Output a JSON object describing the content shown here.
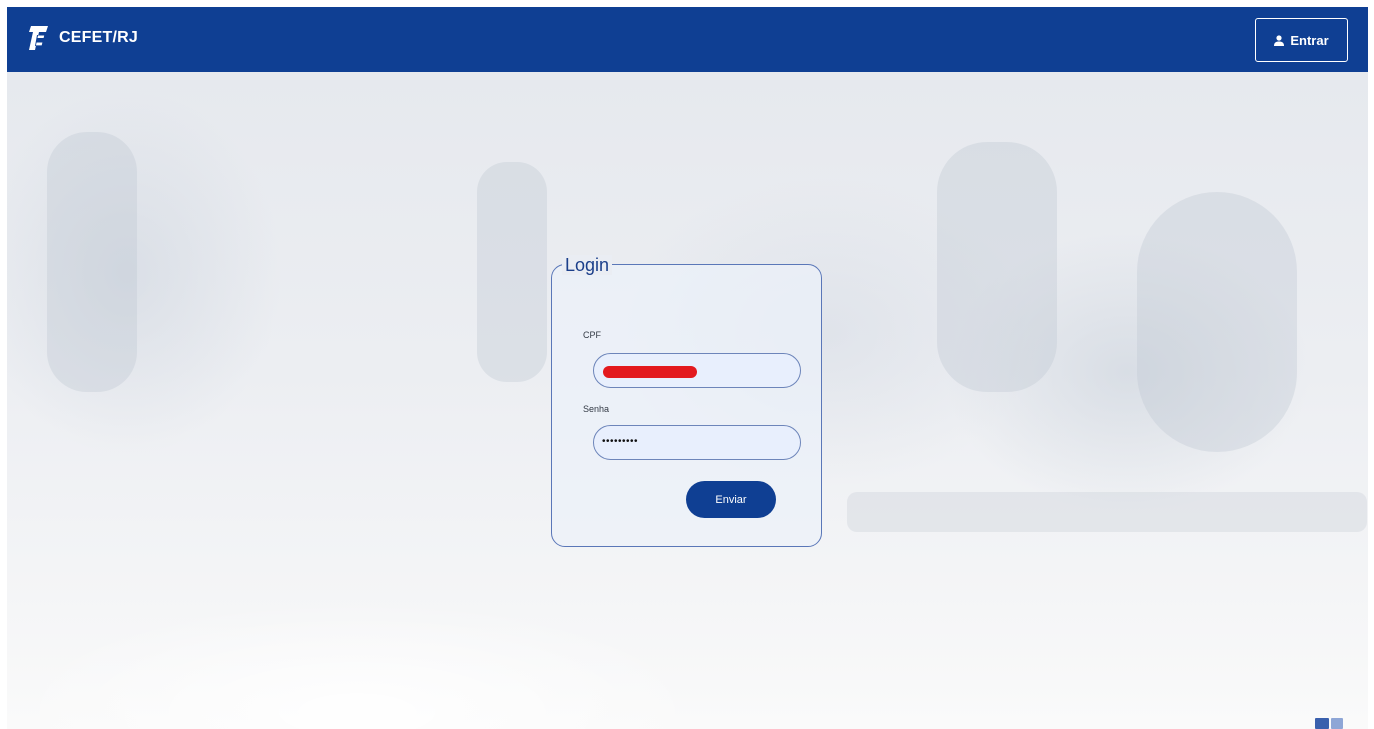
{
  "header": {
    "brand_name": "CEFET/RJ",
    "login_button_label": "Entrar"
  },
  "login_form": {
    "legend": "Login",
    "cpf_label": "CPF",
    "cpf_value_redacted": true,
    "password_label": "Senha",
    "password_value": "•••••••••",
    "submit_label": "Enviar"
  },
  "colors": {
    "header_background": "#0f3f93",
    "card_border": "#5a77b8",
    "input_background": "#e8effd",
    "redaction": "#e3191e",
    "button_background": "#0f3f93"
  },
  "icons": {
    "brand_logo": "cefet-logo-icon",
    "login_button_icon": "user-icon"
  }
}
